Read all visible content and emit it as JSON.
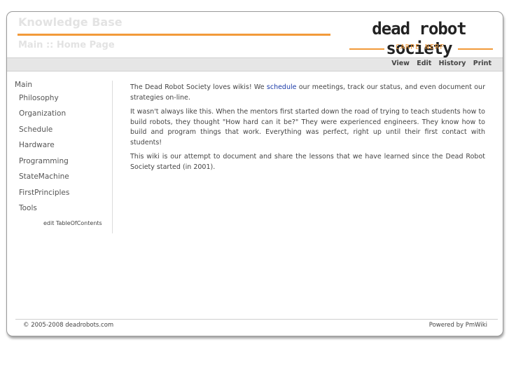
{
  "header": {
    "site_title": "Knowledge Base",
    "page_title": "Main :: Home Page",
    "logo_text": "dead robot society",
    "motto": "CARPE NERF"
  },
  "actions": [
    "View",
    "Edit",
    "History",
    "Print"
  ],
  "sidebar": {
    "heading": "Main",
    "items": [
      "Philosophy",
      "Organization",
      "Schedule",
      "Hardware",
      "Programming",
      "StateMachine",
      "FirstPrinciples",
      "Tools"
    ],
    "edit_link": "edit TableOfContents"
  },
  "content": {
    "p1_before": "The Dead Robot Society loves wikis! We ",
    "p1_link": "schedule",
    "p1_after": " our meetings, track our status, and even document our strategies on-line.",
    "p2": "It wasn't always like this. When the mentors first started down the road of trying to teach students how to build robots, they thought \"How hard can it be?\" They were experienced engineers. They know how to build and program things that work. Everything was perfect, right up until their first contact with students!",
    "p3": "This wiki is our attempt to document and share the lessons that we have learned since the Dead Robot Society started (in 2001)."
  },
  "footer": {
    "copyright": "© 2005-2008 deadrobots.com",
    "powered": "Powered by PmWiki"
  },
  "colors": {
    "accent": "#f29a3a",
    "link": "#1a3aa8",
    "title_text": "#e3e3e3"
  }
}
